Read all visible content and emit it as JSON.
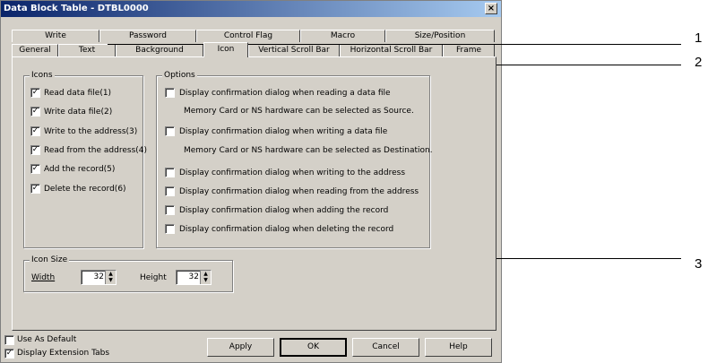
{
  "window": {
    "title": "Data Block Table - DTBL0000",
    "close_glyph": "×"
  },
  "tabs_row1": [
    "Write",
    "Password",
    "Control Flag",
    "Macro",
    "Size/Position"
  ],
  "tabs_row2": [
    "General",
    "Text",
    "Background",
    "Icon",
    "Vertical Scroll Bar",
    "Horizontal Scroll Bar",
    "Frame"
  ],
  "active_tab": "Icon",
  "icons_group": {
    "title": "Icons",
    "items": [
      {
        "label": "Read data file(1)",
        "checked": true
      },
      {
        "label": "Write data file(2)",
        "checked": true
      },
      {
        "label": "Write to the address(3)",
        "checked": true
      },
      {
        "label": "Read from the address(4)",
        "checked": true
      },
      {
        "label": "Add the record(5)",
        "checked": true
      },
      {
        "label": "Delete the record(6)",
        "checked": true
      }
    ]
  },
  "options_group": {
    "title": "Options",
    "items": [
      {
        "label": "Display confirmation dialog when reading a data file",
        "checked": false
      },
      {
        "note": "Memory Card or NS hardware can be selected as Source."
      },
      {
        "label": "Display confirmation dialog when writing a data file",
        "checked": false
      },
      {
        "note": "Memory Card or NS hardware can be selected as Destination."
      },
      {
        "label": "Display confirmation dialog when writing to the address",
        "checked": false
      },
      {
        "label": "Display confirmation dialog when reading from the address",
        "checked": false
      },
      {
        "label": "Display confirmation dialog when adding the record",
        "checked": false
      },
      {
        "label": "Display confirmation dialog when deleting the record",
        "checked": false
      }
    ]
  },
  "icon_size": {
    "title": "Icon Size",
    "width_label": "Width",
    "width_value": "32",
    "height_label": "Height",
    "height_value": "32"
  },
  "footer": {
    "use_as_default": {
      "label": "Use As Default",
      "checked": false
    },
    "display_ext_tabs": {
      "label": "Display Extension Tabs",
      "checked": true
    }
  },
  "buttons": {
    "apply": "Apply",
    "ok": "OK",
    "cancel": "Cancel",
    "help": "Help"
  },
  "callouts": [
    "1",
    "2",
    "3"
  ]
}
